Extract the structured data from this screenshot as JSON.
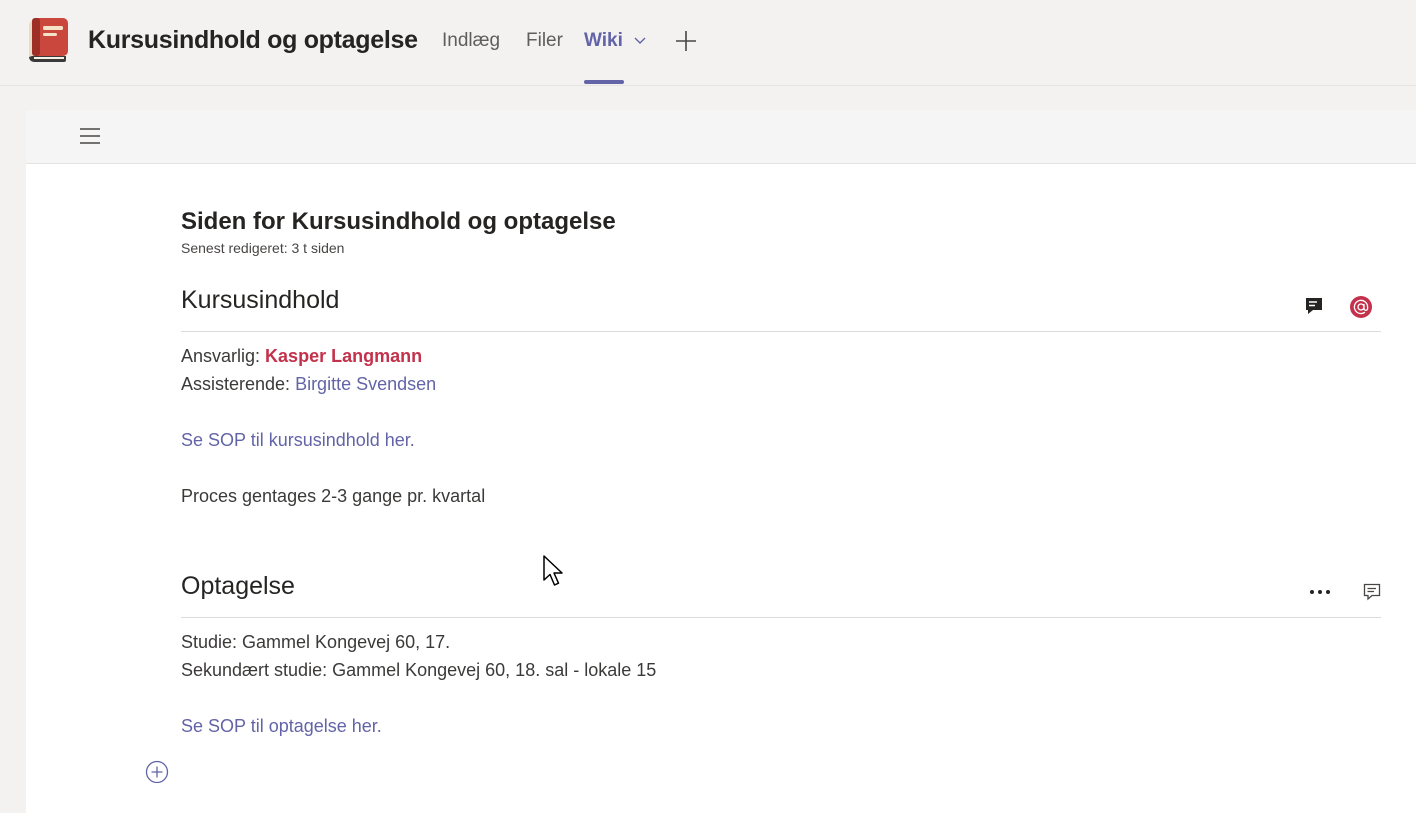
{
  "header": {
    "channel_title": "Kursusindhold og optagelse",
    "tabs": [
      {
        "label": "Indlæg",
        "active": false
      },
      {
        "label": "Filer",
        "active": false
      },
      {
        "label": "Wiki",
        "active": true
      }
    ],
    "icons": [
      "book-logo-icon",
      "chevron-down-icon",
      "plus-icon"
    ]
  },
  "toolbar": {
    "icon": "hamburger-menu-icon"
  },
  "page": {
    "title": "Siden for Kursusindhold og optagelse",
    "last_edited": "Senest redigeret: 3 t siden"
  },
  "sections": [
    {
      "heading": "Kursusindhold",
      "responsible_label": "Ansvarlig: ",
      "responsible_name": "Kasper Langmann",
      "assistant_label": "Assisterende: ",
      "assistant_name": "Birgitte Svendsen",
      "sop_link": "Se SOP til kursusindhold her.",
      "note": "Proces gentages 2-3 gange pr. kvartal",
      "icons": [
        "conversation-filled-icon",
        "mention-badge-icon"
      ]
    },
    {
      "heading": "Optagelse",
      "line1": "Studie: Gammel Kongevej 60, 17.",
      "line2": "Sekundært studie: Gammel Kongevej 60, 18. sal - lokale 15",
      "sop_link": "Se SOP til optagelse her.",
      "icons": [
        "more-options-icon",
        "conversation-outline-icon"
      ]
    }
  ],
  "colors": {
    "accent": "#6264a7",
    "mention": "#c4314b",
    "header_bg": "#f3f2f1",
    "toolbar_bg": "#f5f5f5"
  }
}
